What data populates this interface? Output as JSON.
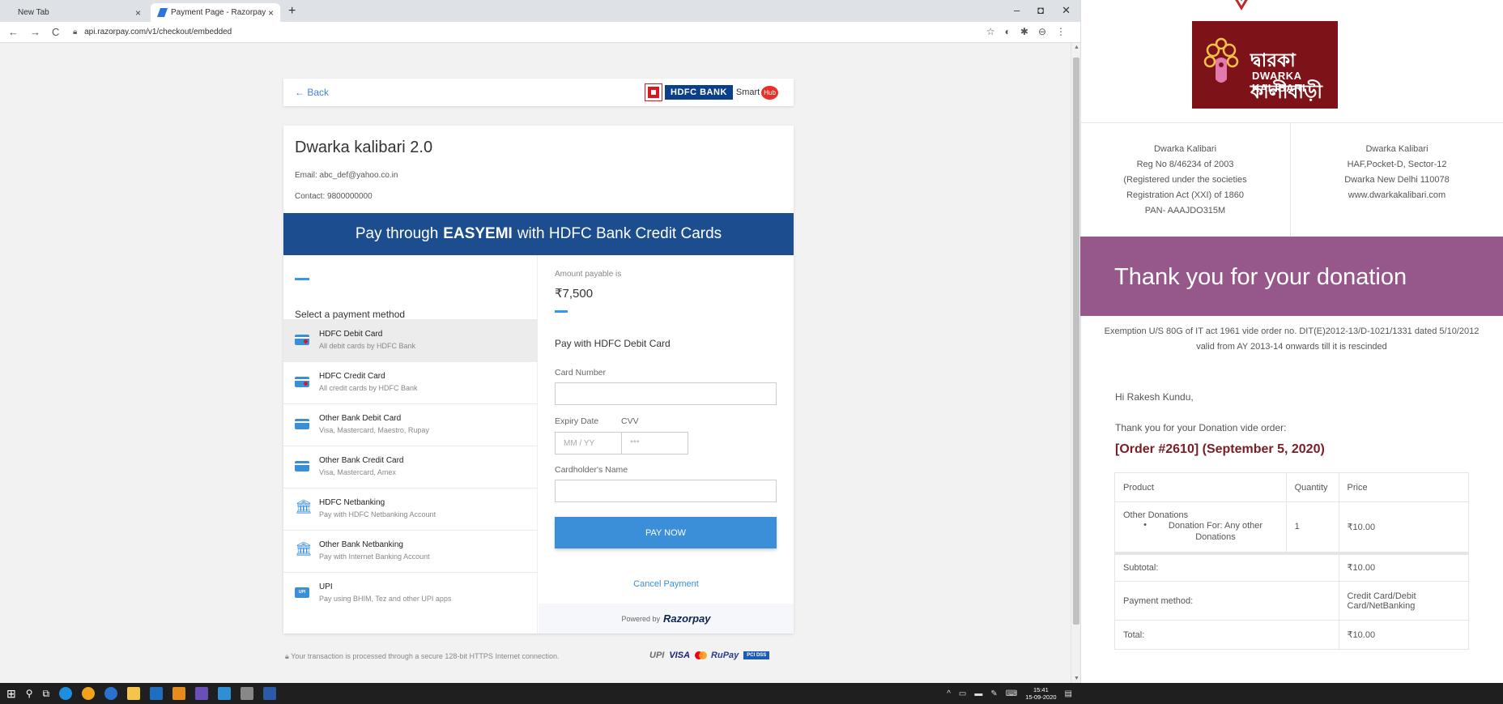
{
  "browser": {
    "tabs": [
      {
        "label": "New Tab",
        "active": false
      },
      {
        "label": "Payment Page - Razorpay",
        "active": true
      }
    ],
    "new_tab": "+",
    "close_glyph": "×",
    "window_controls": {
      "minimize": "–",
      "maximize": "◘",
      "close": "✕"
    },
    "nav": {
      "back": "←",
      "forward": "→",
      "reload": "C"
    },
    "url": "api.razorpay.com/v1/checkout/embedded",
    "toolbar_icons": [
      "star-icon",
      "opera-icon",
      "extensions-icon",
      "profile-icon",
      "menu-icon"
    ]
  },
  "checkout": {
    "back_label": "← Back",
    "bank_brand": "HDFC BANK",
    "smarthub": "Smart",
    "hub": "Hub",
    "merchant_name": "Dwarka kalibari 2.0",
    "email": "Email: abc_def@yahoo.co.in",
    "contact": "Contact: 9800000000",
    "banner_pre": "Pay through",
    "banner_bold": "EASYEMI",
    "banner_post": "with HDFC Bank Credit Cards",
    "select_title": "Select a payment method",
    "methods": [
      {
        "title": "HDFC Debit Card",
        "sub": "All debit cards by HDFC Bank",
        "icon": "card-icon",
        "selected": true
      },
      {
        "title": "HDFC Credit Card",
        "sub": "All credit cards by HDFC Bank",
        "icon": "card-icon",
        "selected": false
      },
      {
        "title": "Other Bank Debit Card",
        "sub": "Visa, Mastercard, Maestro, Rupay",
        "icon": "card-icon",
        "selected": false
      },
      {
        "title": "Other Bank Credit Card",
        "sub": "Visa, Mastercard, Amex",
        "icon": "card-icon",
        "selected": false
      },
      {
        "title": "HDFC Netbanking",
        "sub": "Pay with HDFC Netbanking Account",
        "icon": "bank-icon",
        "selected": false
      },
      {
        "title": "Other Bank Netbanking",
        "sub": "Pay with Internet Banking Account",
        "icon": "bank-icon",
        "selected": false
      },
      {
        "title": "UPI",
        "sub": "Pay using BHIM, Tez and other UPI apps",
        "icon": "upi-icon",
        "selected": false
      }
    ],
    "amount_label": "Amount payable is",
    "amount": "₹7,500",
    "pay_with": "Pay with HDFC Debit Card",
    "card_number_label": "Card Number",
    "card_number_value": "",
    "expiry_label": "Expiry Date",
    "expiry_placeholder": "MM / YY",
    "cvv_label": "CVV",
    "cvv_placeholder": "***",
    "name_label": "Cardholder's Name",
    "name_value": "",
    "pay_now": "PAY NOW",
    "cancel": "Cancel Payment",
    "powered_by": "Powered by",
    "razorpay": "Razorpay",
    "secure_note": "Your transaction is processed through a secure 128-bit HTTPS Internet connection.",
    "footer_logos": {
      "upi": "UPI",
      "visa": "VISA",
      "rupay": "RuPay",
      "pci": "PCI DSS"
    }
  },
  "taskbar": {
    "time": "15:41",
    "date": "15-09-2020",
    "tray": "^"
  },
  "receipt": {
    "logo_bengali": "দ্বারকা কালীবাড়ী",
    "logo_english": "DWARKA KALIBARI",
    "left_address": [
      "Dwarka Kalibari",
      "Reg No 8/46234 of 2003",
      "(Registered under the societies",
      "Registration Act (XXI) of 1860",
      "PAN- AAAJDO315M"
    ],
    "right_address": [
      "Dwarka Kalibari",
      "HAF,Pocket-D, Sector-12",
      "Dwarka New Delhi 110078",
      "www.dwarkakalibari.com"
    ],
    "thanks": "Thank you for your donation",
    "exemption_line1": "Exemption U/S 80G of IT act 1961 vide order no. DIT(E)2012-13/D-1021/1331 dated 5/10/2012",
    "exemption_line2": "valid from AY 2013-14 onwards till it is rescinded",
    "greeting": "Hi Rakesh Kundu,",
    "intro": "Thank you for your Donation vide order:",
    "order_title": "[Order #2610] (September 5, 2020)",
    "table": {
      "headers": [
        "Product",
        "Quantity",
        "Price"
      ],
      "item_name": "Other Donations",
      "item_bullet": "•",
      "item_meta": "Donation For: Any other Donations",
      "item_qty": "1",
      "item_price": "₹10.00",
      "subtotal_label": "Subtotal:",
      "subtotal": "₹10.00",
      "payment_label": "Payment method:",
      "payment_value": "Credit Card/Debit Card/NetBanking",
      "total_label": "Total:",
      "total": "₹10.00"
    }
  },
  "colors": {
    "accent": "#3a8fd8",
    "hdfc_blue": "#1c4e8f",
    "receipt_band": "#96588a",
    "logo_maroon": "#7d1219",
    "order_title": "#7a1d26"
  }
}
